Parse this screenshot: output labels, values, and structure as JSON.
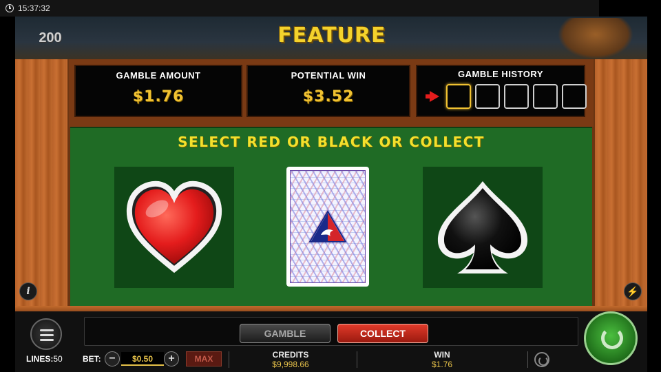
{
  "status_bar": {
    "time": "15:37:32"
  },
  "banner": {
    "small": "",
    "big": "FEATURE",
    "badge_top": "",
    "badge_value": "200"
  },
  "panels": {
    "gamble_amount": {
      "label": "GAMBLE AMOUNT",
      "value": "$1.76"
    },
    "potential_win": {
      "label": "POTENTIAL WIN",
      "value": "$3.52"
    },
    "gamble_history": {
      "label": "GAMBLE HISTORY",
      "slots": 5,
      "active_slot": 1
    }
  },
  "prompt": "SELECT RED OR BLACK OR COLLECT",
  "choices": {
    "red": "hearts",
    "black": "spades"
  },
  "buttons": {
    "gamble": "GAMBLE",
    "collect": "COLLECT",
    "max": "MAX"
  },
  "bottom": {
    "lines_label": "LINES:",
    "lines_value": "50",
    "bet_label": "BET:",
    "bet_value": "$0.50",
    "credits_label": "CREDITS",
    "credits_value": "$9,998.66",
    "win_label": "WIN",
    "win_value": "$1.76"
  },
  "colors": {
    "felt": "#1f6b25",
    "gold": "#f1c232",
    "collect": "#e03a2a",
    "red_suit": "#e41c1c"
  }
}
